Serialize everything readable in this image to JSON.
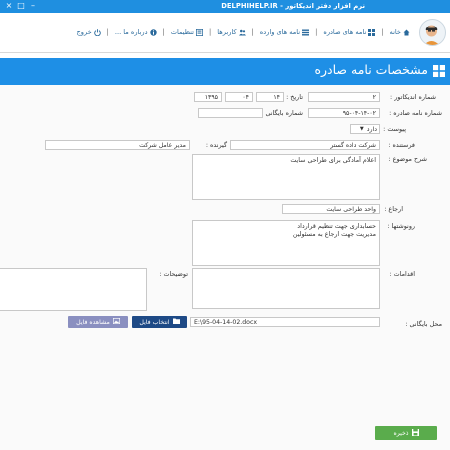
{
  "window": {
    "title": "نرم افزار دفتر اندیکاتور - DELPHIHELP.IR",
    "minimize": "–",
    "maximize": "□",
    "close": "×"
  },
  "nav": {
    "home": "خانه",
    "outgoing": "نامه های صادره",
    "incoming": "نامه های وارده",
    "users": "کاربرها",
    "settings": "تنظیمات",
    "about": "درباره ما ...",
    "exit": "خروج",
    "separator": "|"
  },
  "panel": {
    "title": "مشخصات نامه صادره"
  },
  "form": {
    "indicator_number": {
      "label": "شماره اندیکاتور :",
      "value": "۲"
    },
    "date": {
      "label": "تاریخ :",
      "year": "۱۳۹۵",
      "month": "۰۴",
      "day": "۱۴"
    },
    "outgoing_number": {
      "label": "شماره نامه صادره :",
      "value": "۹۵-۰۴-۱۴-۰۲"
    },
    "archive_number": {
      "label": "شماره بایگانی :",
      "value": ""
    },
    "attachment": {
      "label": "پیوست :",
      "value": "دارد"
    },
    "sender": {
      "label": "فرستنده :",
      "value": "شرکت داده گستر"
    },
    "receiver": {
      "label": "گیرنده :",
      "value": "مدیر عامل شرکت"
    },
    "subject": {
      "label": "شرح موضوع :",
      "value": "اعلام آمادگی برای طراحی سایت"
    },
    "referral": {
      "label": "ارجاع :",
      "value": "واحد طراحی سایت"
    },
    "copies": {
      "label": "رونوشتها :",
      "line1": "حسابداری جهت تنظیم قرارداد",
      "line2": "مدیریت جهت ارجاع به مسئولین"
    },
    "actions": {
      "label": "اقدامات :",
      "value": ""
    },
    "notes": {
      "label": "توضیحات :",
      "value": ""
    },
    "archive_location": {
      "label": "محل بایگانی :",
      "value": "E:\\95-04-14-02.docx"
    }
  },
  "buttons": {
    "choose_file": "انتخاب فایل",
    "view_file": "مشاهده فایل",
    "save": "ذخیره"
  },
  "colors": {
    "titlebar": "#1f8fe0",
    "panel_header": "#1e8fe6",
    "choose_button": "#1e4a86",
    "view_button": "#8a8fc0",
    "save_button": "#5aac4c",
    "nav_link": "#2a6a9c"
  }
}
